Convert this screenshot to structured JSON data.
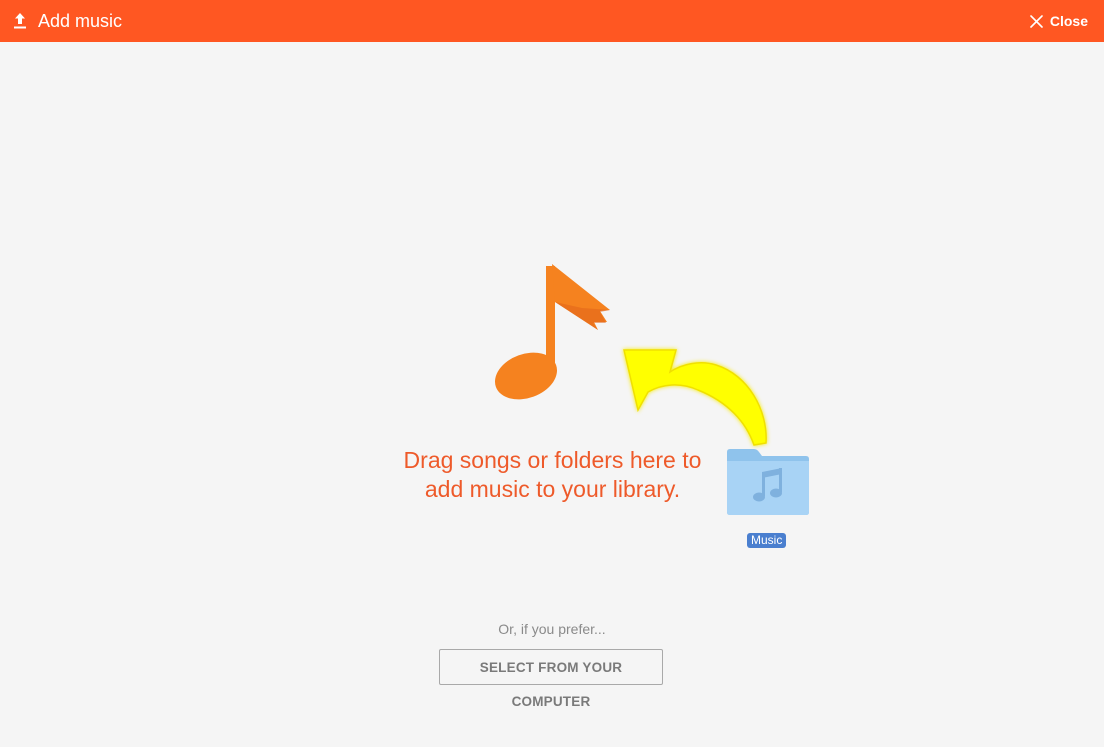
{
  "header": {
    "title": "Add music",
    "upload_icon": "upload-icon",
    "close_label": "Close",
    "close_icon": "close-icon",
    "background_color": "#ff5722"
  },
  "dropzone": {
    "message_line1": "Drag songs or folders here to",
    "message_line2": "add music to your library.",
    "note_icon": "music-note-icon",
    "note_color": "#f5821f",
    "arrow_graphic": "curved-arrow",
    "arrow_color": "#ffff00",
    "folder_icon": "music-folder-icon",
    "folder_label": "Music"
  },
  "alternative": {
    "prefer_text": "Or, if you prefer...",
    "select_button_label": "SELECT FROM YOUR COMPUTER"
  }
}
